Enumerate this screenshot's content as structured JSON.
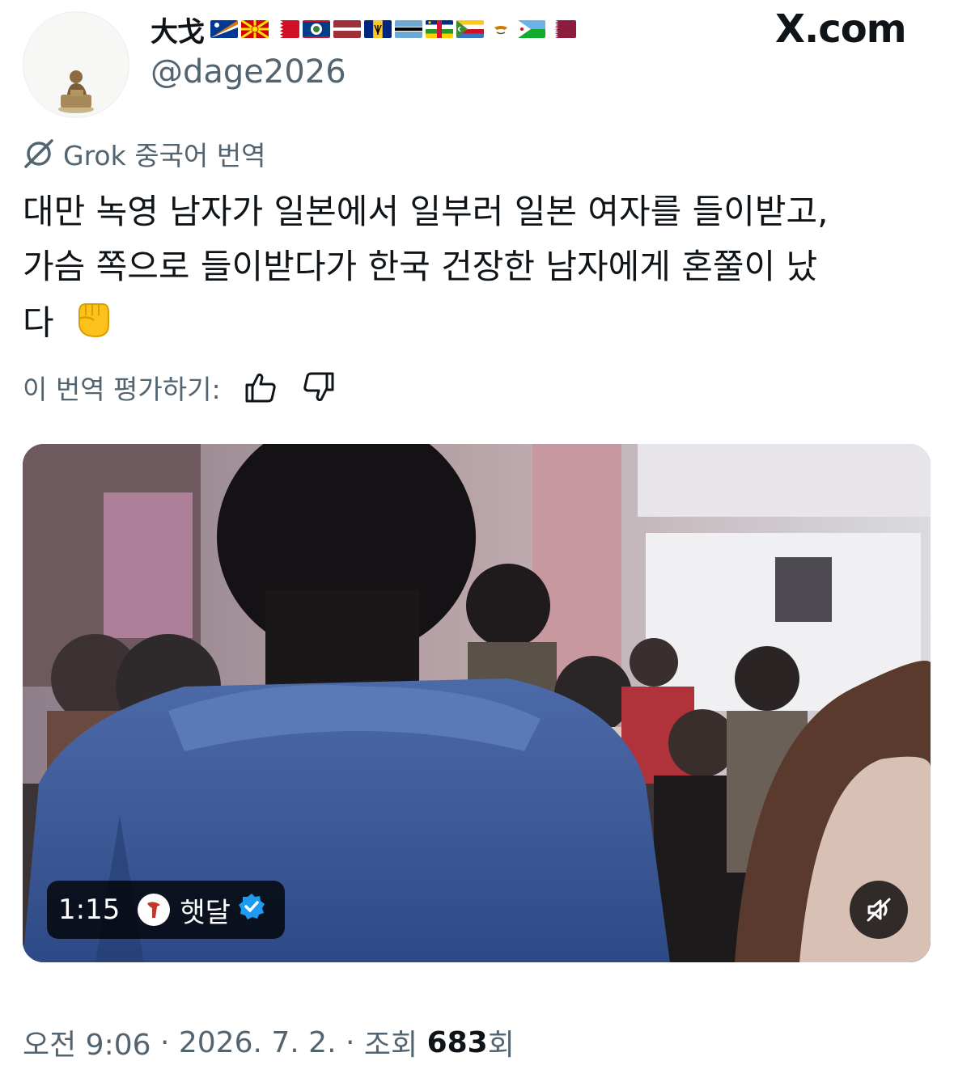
{
  "header": {
    "display_name": "大戈",
    "handle": "@dage2026",
    "site_label": "X.com",
    "avatar_icon": "statue-avatar-icon",
    "flags": [
      "marshall-islands",
      "north-macedonia",
      "bahrain",
      "belize",
      "latvia",
      "barbados",
      "botswana",
      "central-african-republic",
      "comoros",
      "cyprus",
      "djibouti",
      "qatar"
    ]
  },
  "translation": {
    "source_label": "Grok 중국어 번역",
    "grok_icon": "grok-icon",
    "text_lines": [
      "대만 녹영 남자가 일본에서 일부러 일본 여자를 들이받고,",
      "가슴 쪽으로 들이받다가 한국 건장한 남자에게 혼쭐이 났",
      "다"
    ],
    "emoji_icon": "raised-fist-emoji",
    "rate_label": "이 번역 평가하기:",
    "thumbs_up_icon": "thumbs-up-icon",
    "thumbs_down_icon": "thumbs-down-icon"
  },
  "media": {
    "duration": "1:15",
    "channel_name": "햇달",
    "verified_icon": "verified-badge-icon",
    "mute_icon": "muted-speaker-icon"
  },
  "meta": {
    "time": "오전 9:06",
    "sep1": " · ",
    "date": "2026. 7. 2.",
    "sep2": " · ",
    "views_prefix": "조회 ",
    "views_count": "683",
    "views_suffix": "회"
  },
  "colors": {
    "secondary_text": "#536471",
    "primary_text": "#0f1419",
    "verified_blue": "#1d9bf0"
  }
}
